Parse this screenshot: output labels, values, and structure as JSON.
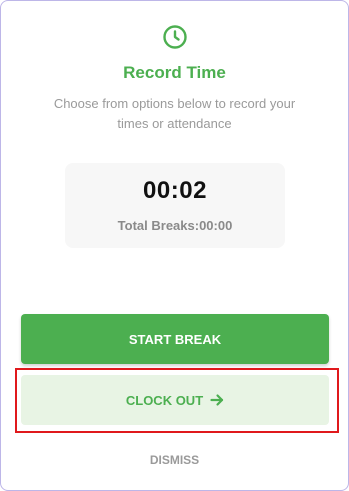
{
  "dialog": {
    "title": "Record Time",
    "subtitle": "Choose from options below to record your times or attendance"
  },
  "timer": {
    "value": "00:02",
    "total_breaks": "Total Breaks:00:00"
  },
  "actions": {
    "start_break_label": "START BREAK",
    "clock_out_label": "CLOCK OUT",
    "dismiss_label": "DISMISS"
  },
  "icons": {
    "header": "clock-icon",
    "clock_out": "arrow-right-icon"
  },
  "colors": {
    "accent": "#4caf50",
    "accent_light": "#e8f4e4",
    "highlight": "#e0191c"
  }
}
